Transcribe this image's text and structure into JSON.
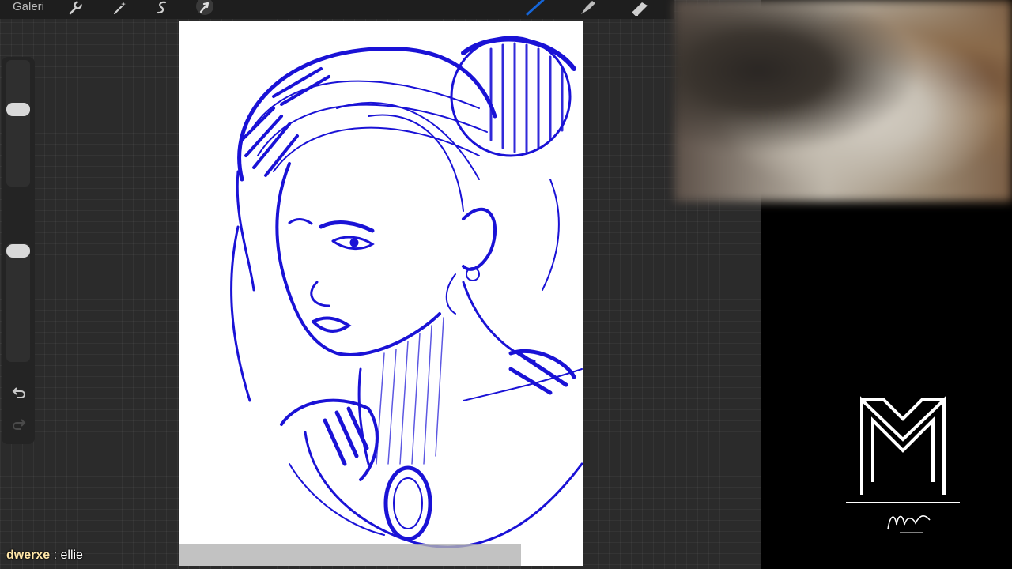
{
  "toolbar": {
    "gallery_label": "Galeri",
    "tools": [
      {
        "name": "actions",
        "icon": "wrench-icon"
      },
      {
        "name": "adjustments",
        "icon": "magic-wand-icon"
      },
      {
        "name": "selection",
        "icon": "selection-s-icon"
      },
      {
        "name": "transform",
        "icon": "arrow-cursor-icon"
      },
      {
        "name": "brush",
        "icon": "brush-icon",
        "active": true,
        "active_color": "#1565d8"
      },
      {
        "name": "smudge",
        "icon": "smudge-finger-icon"
      },
      {
        "name": "eraser",
        "icon": "eraser-icon"
      }
    ]
  },
  "sidebar": {
    "brush_size_slider": {
      "level": 0.85
    },
    "opacity_slider": {
      "level": 0.9
    },
    "modify_icon": "square-icon",
    "undo_icon": "undo-arrow-icon",
    "redo_icon": "redo-arrow-icon"
  },
  "canvas": {
    "background": "#ffffff",
    "ink_color": "#1a12d6",
    "subject": "blue ink portrait sketch"
  },
  "overlay": {
    "chat": {
      "user": "dwerxe",
      "separator": " : ",
      "message": "ellie"
    }
  },
  "colors": {
    "workspace": "#2b2b2b",
    "stream_background": "#000000",
    "chat_user": "#ffe6a8"
  }
}
